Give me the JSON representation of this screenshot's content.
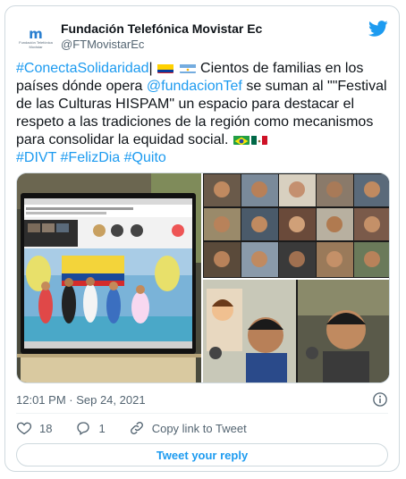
{
  "author": {
    "display_name": "Fundación Telefónica Movistar Ec",
    "handle": "@FTMovistarEc",
    "avatar_mark": "m",
    "avatar_subtext": "Fundación Telefónica Movistar"
  },
  "tweet": {
    "hashtag_1": "#ConectaSolidaridad",
    "separator": "|",
    "text_1": " Cientos de familias en los países dónde opera ",
    "mention": "@fundacionTef",
    "text_2": " se suman al \"\"Festival de las Culturas HISPAM\" un espacio para destacar el respeto a las tradiciones de la región como mecanismos para consolidar la equidad social. ",
    "hashtag_2": "#DIVT",
    "hashtag_3": "#FelizDia",
    "hashtag_4": "#Quito"
  },
  "media": {
    "photo_left_name": "Festival video call on monitor",
    "photo_right_top_name": "Video call participants grid",
    "photo_right_bottom_name": "Children on video call"
  },
  "meta": {
    "timestamp": "12:01 PM · Sep 24, 2021"
  },
  "actions": {
    "like_count": "18",
    "reply_count": "1",
    "copy_link_label": "Copy link to Tweet"
  },
  "reply_button_label": "Tweet your reply",
  "colors": {
    "accent": "#1d9bf0",
    "text": "#0f1419",
    "muted": "#536471",
    "border": "#cfd9de"
  }
}
